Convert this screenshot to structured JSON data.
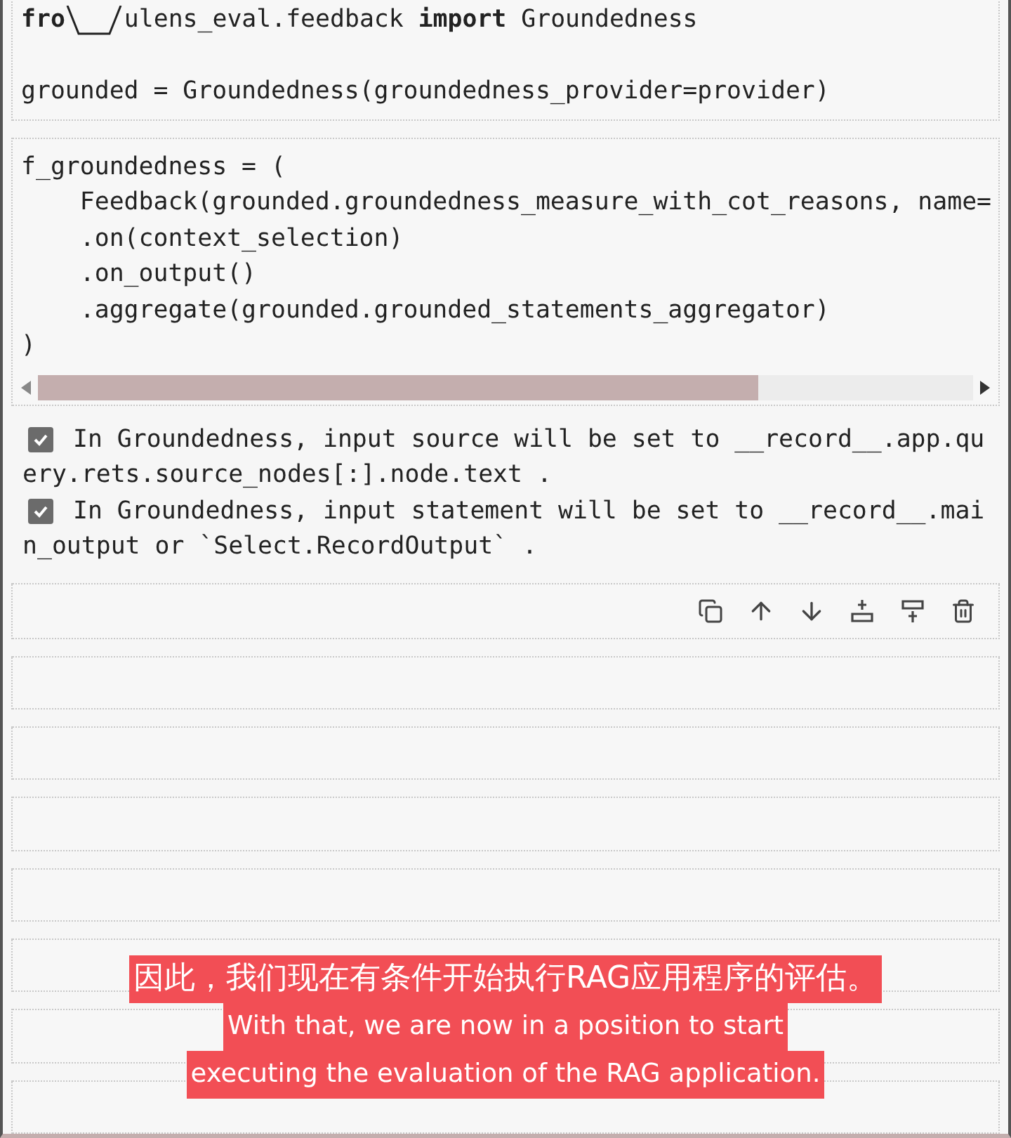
{
  "cells": [
    {
      "kind": "code",
      "groups": [
        [
          {
            "parts": [
              "fro",
              "ulens_eval.feedback **import** Groundedness"
            ]
          }
        ],
        [
          "grounded = Groundedness(groundedness_provider=provider)"
        ]
      ]
    },
    {
      "kind": "wide_code",
      "groups": [
        [
          "f_groundedness = (",
          "    Feedback(grounded.groundedness_measure_with_cot_reasons, name=",
          "    .on(context_selection)",
          "    .on_output()",
          "    .aggregate(grounded.grounded_statements_aggregator)",
          ")"
        ]
      ]
    },
    {
      "kind": "output",
      "items": [
        {
          "checked": true,
          "lines": [
            "In Groundedness, input source will be set to __record__.app.qu",
            "ery.rets.source_nodes[:].node.text ."
          ]
        },
        {
          "checked": true,
          "lines": [
            "In Groundedness, input statement will be set to __record__.mai",
            "n_output or `Select.RecordOutput` ."
          ]
        }
      ]
    },
    {
      "kind": "active"
    },
    {
      "kind": "empty"
    },
    {
      "kind": "empty"
    },
    {
      "kind": "empty"
    },
    {
      "kind": "empty"
    },
    {
      "kind": "empty"
    },
    {
      "kind": "empty"
    },
    {
      "kind": "empty"
    }
  ],
  "subtitle": {
    "zh": "因此，我们现在有条件开始执行RAG应用程序的评估。",
    "en": [
      "With that, we are now in a position to start",
      "executing the evaluation of the RAG application."
    ]
  }
}
